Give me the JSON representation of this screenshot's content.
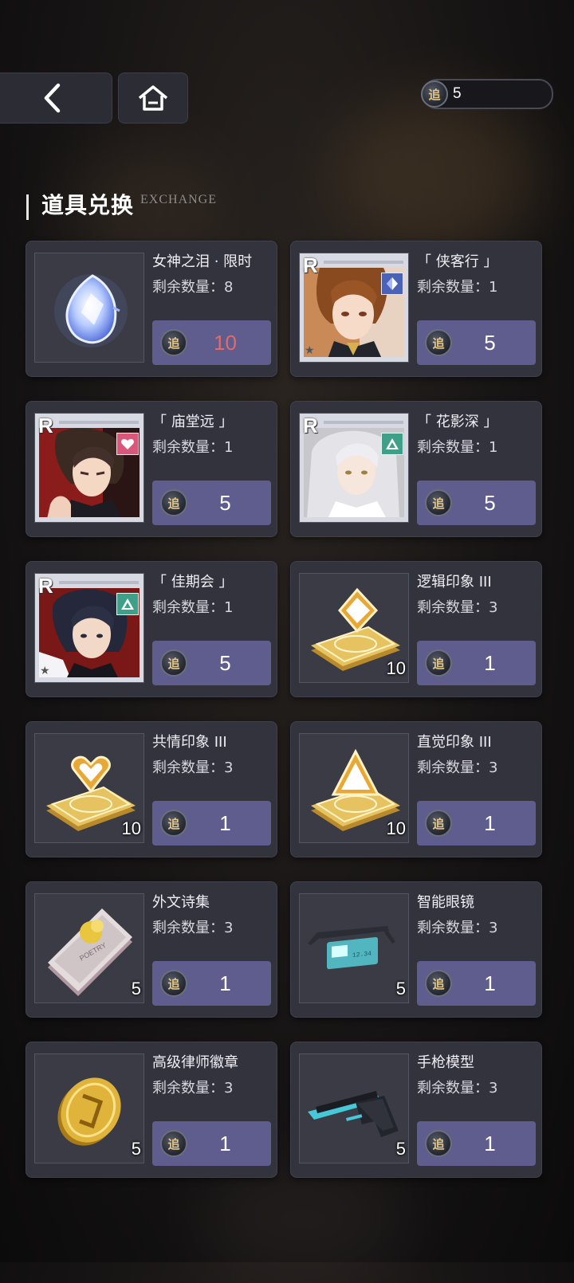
{
  "header": {
    "back_icon": "chevron-left-icon",
    "home_icon": "home-icon",
    "currency_icon": "coin-icon",
    "currency_glyph": "追",
    "currency_amount": "5"
  },
  "section": {
    "title": "道具兑换",
    "subtitle": "EXCHANGE"
  },
  "items": [
    {
      "name": "女神之泪 · 限时",
      "stock": "剩余数量：8",
      "price": "10",
      "icon": "tear-gem-icon",
      "price_color": "#e46a6a"
    },
    {
      "name": "「 侠客行 」",
      "stock": "剩余数量：1",
      "price": "5",
      "icon": "card-portrait-brown-hair",
      "rarity": "R",
      "attribute_icon": "diamond-blue-icon"
    },
    {
      "name": "「 庙堂远 」",
      "stock": "剩余数量：1",
      "price": "5",
      "icon": "card-portrait-dark-hair",
      "rarity": "R",
      "attribute_icon": "heart-pink-icon"
    },
    {
      "name": "「 花影深 」",
      "stock": "剩余数量：1",
      "price": "5",
      "icon": "card-portrait-silver-hair",
      "rarity": "R",
      "attribute_icon": "triangle-green-icon"
    },
    {
      "name": "「 佳期会 」",
      "stock": "剩余数量：1",
      "price": "5",
      "icon": "card-portrait-black-hair",
      "rarity": "R",
      "attribute_icon": "triangle-green-icon"
    },
    {
      "name": "逻辑印象 III",
      "stock": "剩余数量：3",
      "price": "1",
      "icon": "logic-impression-icon",
      "qty": "10"
    },
    {
      "name": "共情印象 III",
      "stock": "剩余数量：3",
      "price": "1",
      "icon": "empathy-impression-icon",
      "qty": "10"
    },
    {
      "name": "直觉印象 III",
      "stock": "剩余数量：3",
      "price": "1",
      "icon": "intuition-impression-icon",
      "qty": "10"
    },
    {
      "name": "外文诗集",
      "stock": "剩余数量：3",
      "price": "1",
      "icon": "poetry-book-icon",
      "qty": "5"
    },
    {
      "name": "智能眼镜",
      "stock": "剩余数量：3",
      "price": "1",
      "icon": "smart-glasses-icon",
      "qty": "5"
    },
    {
      "name": "高级律师徽章",
      "stock": "剩余数量：3",
      "price": "1",
      "icon": "lawyer-badge-icon",
      "qty": "5"
    },
    {
      "name": "手枪模型",
      "stock": "剩余数量：3",
      "price": "1",
      "icon": "pistol-model-icon",
      "qty": "5"
    }
  ],
  "colors": {
    "price_button": "#5e5d8e",
    "card_bg": "#32333d",
    "limited_price": "#e46a6a"
  }
}
